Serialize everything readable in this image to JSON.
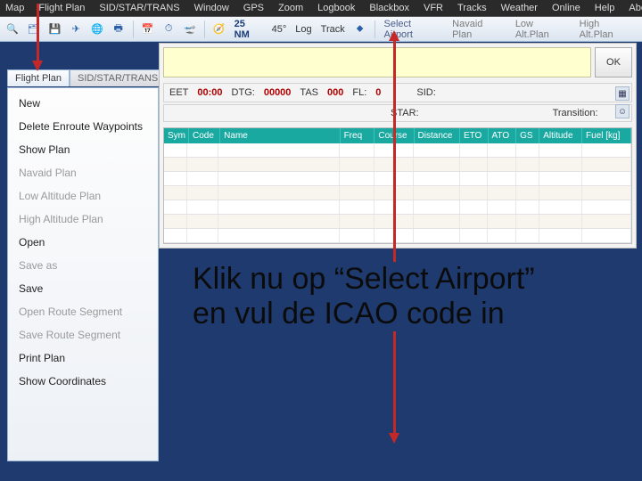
{
  "menubar": [
    "Map",
    "Flight Plan",
    "SID/STAR/TRANS",
    "Window",
    "GPS",
    "Zoom",
    "Logbook",
    "Blackbox",
    "VFR",
    "Tracks",
    "Weather",
    "Online",
    "Help",
    "About"
  ],
  "toolbar": {
    "label_log": "Log",
    "label_track": "Track",
    "scale": "25 NM",
    "rot": "45°",
    "links": {
      "select_airport": "Select Airport",
      "navaid_plan": "Navaid Plan",
      "low_alt_plan": "Low Alt.Plan",
      "high_alt_plan": "High Alt.Plan"
    }
  },
  "tabs": {
    "flight_plan": "Flight Plan",
    "sid_star": "SID/STAR/TRANS"
  },
  "sidebar": {
    "items": [
      {
        "label": "New",
        "dim": false
      },
      {
        "label": "Delete Enroute Waypoints",
        "dim": false
      },
      {
        "label": "Show Plan",
        "dim": false
      },
      {
        "label": "Navaid Plan",
        "dim": true
      },
      {
        "label": "Low Altitude Plan",
        "dim": true
      },
      {
        "label": "High Altitude Plan",
        "dim": true
      },
      {
        "label": "Open",
        "dim": false
      },
      {
        "label": "Save as",
        "dim": true
      },
      {
        "label": "Save",
        "dim": false
      },
      {
        "label": "Open Route Segment",
        "dim": true
      },
      {
        "label": "Save Route Segment",
        "dim": true
      },
      {
        "label": "Print Plan",
        "dim": false
      },
      {
        "label": "Show Coordinates",
        "dim": false
      }
    ]
  },
  "info": {
    "eet_lbl": "EET",
    "eet_val": "00:00",
    "dtg_lbl": "DTG:",
    "dtg_val": "00000",
    "tas_lbl": "TAS",
    "tas_val": "000",
    "fl_lbl": "FL:",
    "fl_val": "0",
    "sid_lbl": "SID:",
    "star_lbl": "STAR:",
    "trans_lbl": "Transition:"
  },
  "grid_headers": [
    "Sym",
    "Code",
    "Name",
    "Freq",
    "Course",
    "Distance",
    "ETO",
    "ATO",
    "GS",
    "Altitude",
    "Fuel [kg]"
  ],
  "ok_button": "OK",
  "callout_line1": "Klik nu op “Select Airport”",
  "callout_line2": "en vul de ICAO code in"
}
